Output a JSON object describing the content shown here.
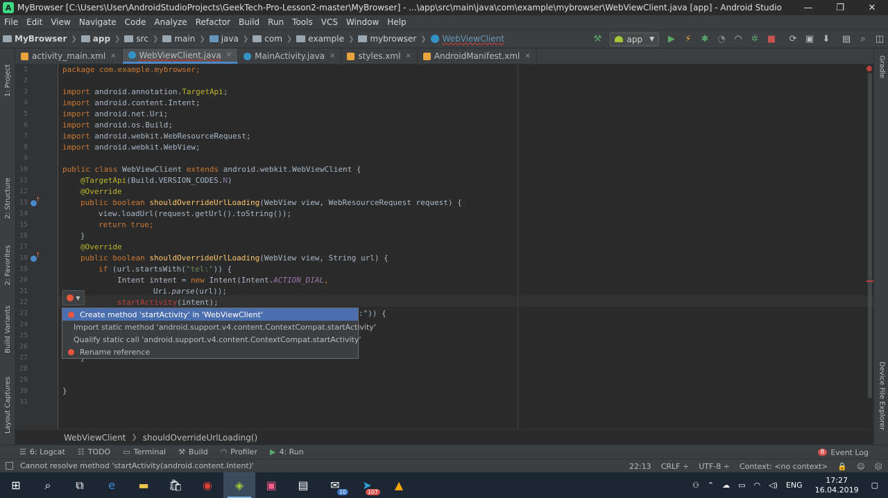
{
  "window": {
    "title": "MyBrowser [C:\\Users\\User\\AndroidStudioProjects\\GeekTech-Pro-Lesson2-master\\MyBrowser] - ...\\app\\src\\main\\java\\com\\example\\mybrowser\\WebViewClient.java [app] - Android Studio",
    "minimize": "—",
    "maximize": "❐",
    "close": "✕"
  },
  "menu": [
    "File",
    "Edit",
    "View",
    "Navigate",
    "Code",
    "Analyze",
    "Refactor",
    "Build",
    "Run",
    "Tools",
    "VCS",
    "Window",
    "Help"
  ],
  "nav": {
    "crumbs": [
      "MyBrowser",
      "app",
      "src",
      "main",
      "java",
      "com",
      "example",
      "mybrowser",
      "WebViewClient"
    ],
    "run_config": "app"
  },
  "left_tabs": [
    "1: Project",
    "2: Structure",
    "2: Favorites",
    "Build Variants",
    "Layout Captures"
  ],
  "right_tabs": [
    "Gradle",
    "Device File Explorer"
  ],
  "tabs": [
    {
      "label": "activity_main.xml",
      "icon": "xml-file-icon"
    },
    {
      "label": "WebViewClient.java",
      "icon": "class-icon",
      "active": true
    },
    {
      "label": "MainActivity.java",
      "icon": "class-icon"
    },
    {
      "label": "styles.xml",
      "icon": "xml-file-icon"
    },
    {
      "label": "AndroidManifest.xml",
      "icon": "manifest-icon"
    }
  ],
  "line_numbers": [
    "1",
    "2",
    "3",
    "4",
    "5",
    "6",
    "7",
    "8",
    "9",
    "10",
    "11",
    "12",
    "13",
    "14",
    "15",
    "16",
    "17",
    "18",
    "19",
    "20",
    "21",
    "22",
    "23",
    "24",
    "25",
    "26",
    "27",
    "28",
    "29",
    "30",
    "31"
  ],
  "code": {
    "l1": "package com.example.mybrowser;",
    "l3a": "import ",
    "l3b": "android.annotation.",
    "l3c": "TargetApi",
    "l3d": ";",
    "l4a": "import ",
    "l4b": "android.content.Intent;",
    "l5a": "import ",
    "l5b": "android.net.Uri;",
    "l6a": "import ",
    "l6b": "android.os.Build;",
    "l7a": "import ",
    "l7b": "android.webkit.WebResourceRequest;",
    "l8a": "import ",
    "l8b": "android.webkit.WebView;",
    "l10a": "public class ",
    "l10b": "WebViewClient ",
    "l10c": "extends ",
    "l10d": "android.webkit.WebViewClient {",
    "l11a": "@TargetApi",
    "l11b": "(Build.VERSION_CODES.",
    "l11c": "N",
    "l11d": ")",
    "l12": "@Override",
    "l13a": "public boolean ",
    "l13b": "shouldOverrideUrlLoading",
    "l13c": "(WebView view, WebResourceRequest request) {",
    "l14": "view.loadUrl(request.getUrl().toString());",
    "l15a": "return ",
    "l15b": "true",
    "l15c": ";",
    "l16": "}",
    "l17": "@Override",
    "l18a": "public boolean ",
    "l18b": "shouldOverrideUrlLoading",
    "l18c": "(WebView view, String url) {",
    "l19a": "if ",
    "l19b": "(url.startsWith(",
    "l19c": "\"tel:\"",
    "l19d": ")) {",
    "l20a": "Intent intent = ",
    "l20b": "new ",
    "l20c": "Intent(Intent.",
    "l20d": "ACTION_DIAL",
    "l20e": ",",
    "l21a": "Uri.",
    "l21b": "parse",
    "l21c": "(url));",
    "l22a": "startActivity",
    "l22b": "(intent);",
    "l23": ":\")) {",
    "l27": "}",
    "l30": "}"
  },
  "intention_popup": [
    "Create method 'startActivity' in 'WebViewClient'",
    "Import static method 'android.support.v4.content.ContextCompat.startActivity'",
    "Qualify static call 'android.support.v4.content.ContextCompat.startActivity'",
    "Rename reference"
  ],
  "breadcrumb": [
    "WebViewClient",
    "shouldOverrideUrlLoading()"
  ],
  "tool_windows": [
    {
      "label": "6: Logcat",
      "icon": "logcat-icon"
    },
    {
      "label": "TODO",
      "icon": "todo-icon"
    },
    {
      "label": "Terminal",
      "icon": "terminal-icon"
    },
    {
      "label": "Build",
      "icon": "hammer-icon"
    },
    {
      "label": "Profiler",
      "icon": "profiler-icon"
    },
    {
      "label": "4: Run",
      "icon": "run-icon"
    }
  ],
  "event_log": {
    "count": "8",
    "label": "Event Log"
  },
  "status": {
    "message": "Cannot resolve method 'startActivity(android.content.Intent)'",
    "position": "22:13",
    "line_sep": "CRLF ÷",
    "encoding": "UTF-8 ÷",
    "context": "Context: <no context>"
  },
  "taskbar": {
    "apps": [
      "windows-start-icon",
      "search-icon",
      "task-view-icon",
      "edge-icon",
      "explorer-icon",
      "store-icon",
      "chrome-icon",
      "android-studio-icon",
      "intellij-icon",
      "app-icon",
      "mail-icon",
      "telegram-icon",
      "avast-icon"
    ],
    "mail_badge": "10",
    "telegram_badge": "107",
    "lang": "ENG",
    "time": "17:27",
    "date": "16.04.2019"
  }
}
